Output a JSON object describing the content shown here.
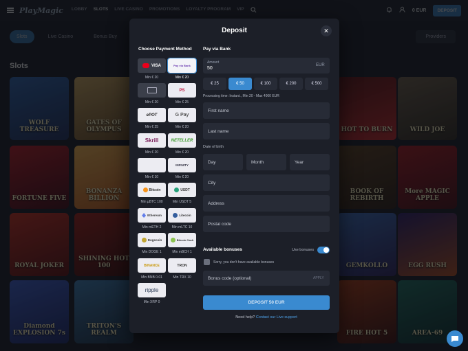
{
  "header": {
    "logo": "PlayMagic",
    "nav": [
      "LOBBY",
      "SLOTS",
      "LIVE CASINO",
      "PROMOTIONS",
      "LOYALTY PROGRAM",
      "VIP"
    ],
    "balance": "0 EUR",
    "deposit_label": "DEPOSIT"
  },
  "subnav": [
    "Slots",
    "Live Casino",
    "Bonus Buy"
  ],
  "providers_label": "Providers",
  "section_title": "Slots",
  "games": [
    "WOLF TREASURE",
    "GATES OF OLYMPUS",
    "",
    "",
    "HOT TO BURN",
    "WILD JOE",
    "FORTUNE FIVE",
    "BONANZA BILLION",
    "",
    "",
    "BOOK OF REBIRTH",
    "More MAGIC APPLE",
    "ROYAL JOKER",
    "SHINING HOT 100",
    "",
    "",
    "GEMKOLLO",
    "EGG RUSH",
    "Diamond EXPLOSION 7s",
    "TRITON'S REALM",
    "",
    "",
    "FIRE HOT 5",
    "AREA-69"
  ],
  "modal": {
    "title": "Deposit",
    "choose_title": "Choose Payment Method",
    "pay_title": "Pay via Bank",
    "methods": [
      {
        "label": "VISA",
        "min": "Min € 20"
      },
      {
        "label": "Pay via Bank",
        "min": "Min € 20"
      },
      {
        "label": "",
        "min": "Min € 20"
      },
      {
        "label": "PS",
        "min": "Min € 25"
      },
      {
        "label": "ePOT",
        "min": "Min € 25"
      },
      {
        "label": "G Pay",
        "min": "Min € 20"
      },
      {
        "label": "Skrill",
        "min": "Min € 20"
      },
      {
        "label": "NETELLER",
        "min": "Min € 20"
      },
      {
        "label": "",
        "min": "Min € 10"
      },
      {
        "label": "INFINITY",
        "min": "Min € 20"
      },
      {
        "label": "Bitcoin",
        "min": "Min µBTC 100"
      },
      {
        "label": "USDT",
        "min": "Min USDT 5"
      },
      {
        "label": "Ethereum",
        "min": "Min mETH 2"
      },
      {
        "label": "Litecoin",
        "min": "Min mLTC 10"
      },
      {
        "label": "Dogecoin",
        "min": "Min DOGE 1"
      },
      {
        "label": "Bitcoin Cash",
        "min": "Min mBCH 1"
      },
      {
        "label": "BINANCE",
        "min": "Min BNB 0.01"
      },
      {
        "label": "TRON",
        "min": "Min TRX 10"
      },
      {
        "label": "ripple",
        "min": "Min XRP 0"
      }
    ],
    "amount_label": "Amount",
    "amount_value": "50",
    "currency": "EUR",
    "chips": [
      "€ 25",
      "€ 50",
      "€ 100",
      "€ 200",
      "€ 500"
    ],
    "processing": "Processing time: Instant., Min 20 - Max 4000 EUR",
    "first_name": "First name",
    "last_name": "Last name",
    "dob_label": "Date of birth",
    "day": "Day",
    "month": "Month",
    "year": "Year",
    "city": "City",
    "address": "Address",
    "postal": "Postal code",
    "bonuses_title": "Available bonuses",
    "use_bonuses": "Use bonuses",
    "no_bonus": "Sorry, you don't have available bonuses",
    "bonus_placeholder": "Bonus code (optional)",
    "apply": "APPLY",
    "submit": "DEPOSIT 50 EUR",
    "help": "Need help?",
    "help_link": "Contact our Live support"
  },
  "colors": {
    "accent": "#3a8ad0",
    "modal_bg": "#1c1f28",
    "field_bg": "#272b36"
  }
}
